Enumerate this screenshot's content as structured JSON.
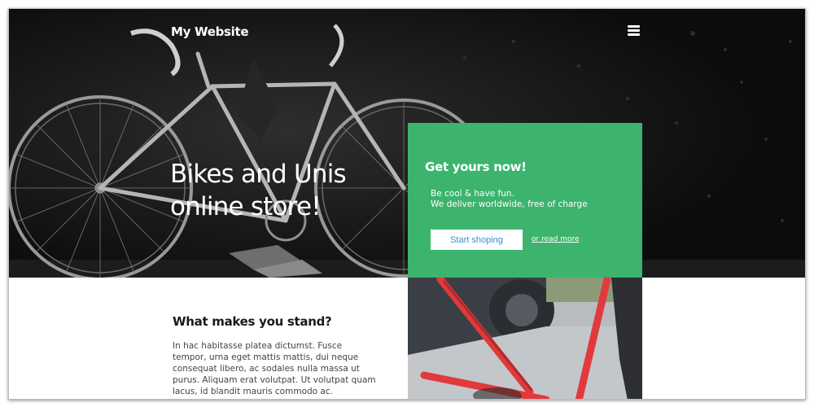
{
  "header": {
    "site_title": "My Website",
    "menu_icon": "hamburger-menu-icon"
  },
  "hero": {
    "heading": "Bikes and Unis online store!",
    "background_image": "black-and-white road bicycle photo"
  },
  "cta": {
    "title": "Get yours now!",
    "line1": "Be cool & have fun.",
    "line2": "We deliver worldwide, free of charge",
    "button_label": "Start shoping",
    "link_label": "or read more",
    "accent_color": "#3cb46e",
    "button_text_color": "#3a8fd0"
  },
  "section": {
    "title": "What makes you stand?",
    "body": "In hac habitasse platea dictumst. Fusce tempor, urna eget mattis mattis, dui neque consequat libero, ac sodales nulla massa ut purus. Aliquam erat volutpat. Ut volutpat quam lacus, id blandit mauris commodo ac."
  },
  "photo": {
    "subject": "red bicycle frame photo"
  }
}
